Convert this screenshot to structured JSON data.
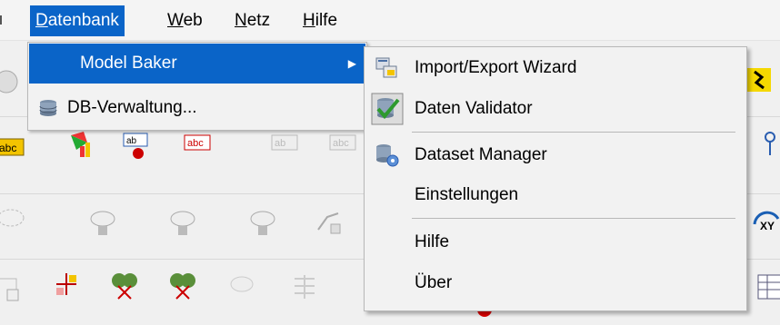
{
  "menubar": {
    "items": [
      {
        "label": "Datenbank",
        "accel": "D",
        "rest": "atenbank"
      },
      {
        "label": "Web",
        "accel": "W",
        "rest": "eb"
      },
      {
        "label": "Netz",
        "accel": "N",
        "rest": "etz"
      },
      {
        "label": "Hilfe",
        "accel": "H",
        "rest": "ilfe"
      }
    ]
  },
  "datenbank_menu": {
    "items": [
      {
        "label": "Model Baker",
        "icon": "none",
        "has_submenu": true
      },
      {
        "label": "DB-Verwaltung...",
        "icon": "database-icon"
      }
    ]
  },
  "model_baker_submenu": {
    "items": [
      {
        "label": "Import/Export Wizard",
        "icon": "wizard-icon"
      },
      {
        "label": "Daten Validator",
        "icon": "validator-checkmark-icon"
      },
      {
        "label": "Dataset Manager",
        "icon": "dataset-manager-icon"
      },
      {
        "label": "Einstellungen",
        "icon": "none"
      },
      {
        "label": "Hilfe",
        "icon": "none"
      },
      {
        "label": "Über",
        "icon": "none"
      }
    ]
  },
  "colors": {
    "highlight": "#0a64c8",
    "menu_bg": "#f2f2f2",
    "toolbar_bg": "#f0f0f0"
  }
}
